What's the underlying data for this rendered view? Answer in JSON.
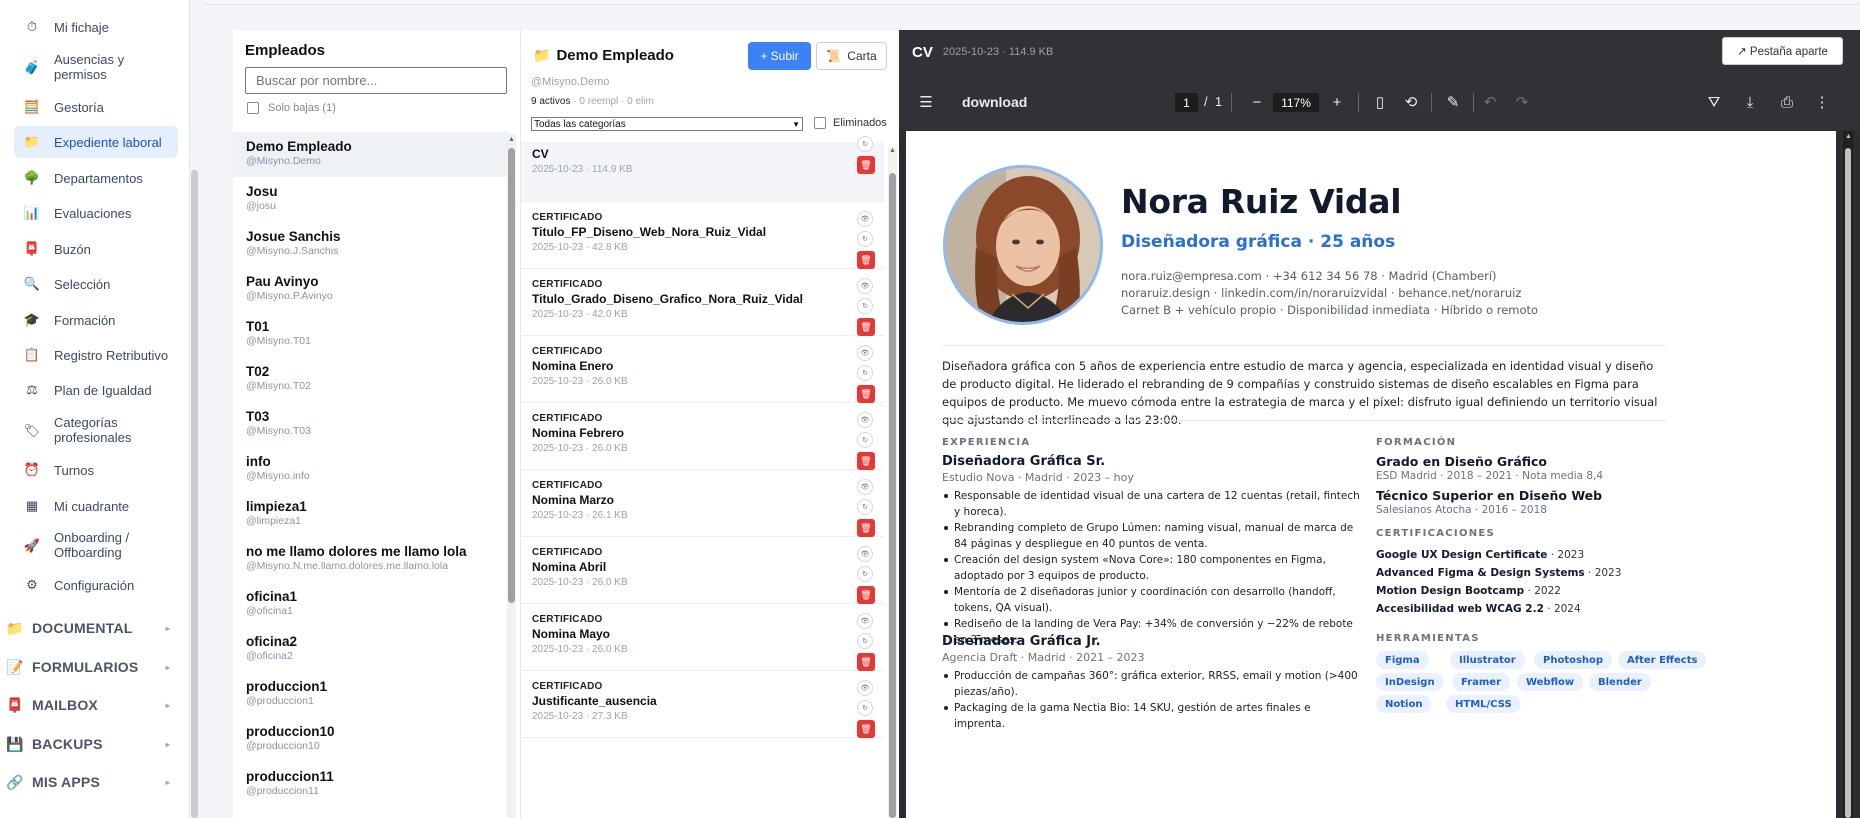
{
  "sidebar": {
    "items": [
      {
        "label": "Mi fichaje",
        "icon": "stopwatch-icon"
      },
      {
        "label": "Ausencias y permisos",
        "icon": "luggage-icon"
      },
      {
        "label": "Gestoría",
        "icon": "calculator-icon"
      },
      {
        "label": "Expediente laboral",
        "icon": "folder-icon",
        "active": true
      },
      {
        "label": "Departamentos",
        "icon": "tree-icon"
      },
      {
        "label": "Evaluaciones",
        "icon": "bar-chart-icon"
      },
      {
        "label": "Buzón",
        "icon": "mailbox-icon"
      },
      {
        "label": "Selección",
        "icon": "magnifier-icon"
      },
      {
        "label": "Formación",
        "icon": "graduation-cap-icon"
      },
      {
        "label": "Registro Retributivo",
        "icon": "clipboard-icon"
      },
      {
        "label": "Plan de Igualdad",
        "icon": "scales-icon"
      },
      {
        "label": "Categorías profesionales",
        "icon": "tag-icon"
      },
      {
        "label": "Turnos",
        "icon": "alarm-clock-icon"
      },
      {
        "label": "Mi cuadrante",
        "icon": "calendar-grid-icon"
      },
      {
        "label": "Onboarding / Offboarding",
        "icon": "rocket-icon"
      },
      {
        "label": "Configuración",
        "icon": "gear-icon"
      }
    ],
    "groups": [
      {
        "label": "DOCUMENTAL",
        "icon": "folder-icon"
      },
      {
        "label": "FORMULARIOS",
        "icon": "form-icon"
      },
      {
        "label": "MAILBOX",
        "icon": "mailbox-icon"
      },
      {
        "label": "BACKUPS",
        "icon": "floppy-icon"
      },
      {
        "label": "MIS APPS",
        "icon": "link-icon"
      }
    ]
  },
  "employees": {
    "title": "Empleados",
    "search_placeholder": "Buscar por nombre...",
    "only_inactive_label": "Solo bajas (1)",
    "list": [
      {
        "name": "Demo Empleado",
        "handle": "@Misyno.Demo"
      },
      {
        "name": "Josu",
        "handle": "@josu"
      },
      {
        "name": "Josue Sanchis",
        "handle": "@Misyno.J.Sanchis"
      },
      {
        "name": "Pau Avinyo",
        "handle": "@Misyno.P.Avinyo"
      },
      {
        "name": "T01",
        "handle": "@Misyno.T01"
      },
      {
        "name": "T02",
        "handle": "@Misyno.T02"
      },
      {
        "name": "T03",
        "handle": "@Misyno.T03"
      },
      {
        "name": "info",
        "handle": "@Misyno.info"
      },
      {
        "name": "limpieza1",
        "handle": "@limpieza1"
      },
      {
        "name": "no me llamo dolores me llamo lola",
        "handle": "@Misyno.N.me.llamo.dolores.me.llamo.lola"
      },
      {
        "name": "oficina1",
        "handle": "@oficina1"
      },
      {
        "name": "oficina2",
        "handle": "@oficina2"
      },
      {
        "name": "produccion1",
        "handle": "@produccion1"
      },
      {
        "name": "produccion10",
        "handle": "@produccion10"
      },
      {
        "name": "produccion11",
        "handle": "@produccion11"
      }
    ]
  },
  "docs": {
    "title": "Demo Empleado",
    "upload_label": "+ Subir",
    "carta_label": "Carta",
    "handle": "@Misyno.Demo",
    "active_count": "9",
    "active_label": "activos",
    "stats_rest": "· 0 reempl · 0 elim",
    "category_select": "Todas las categorías",
    "deleted_label": "Eliminados",
    "list": [
      {
        "kind": "",
        "name": "CV",
        "meta": "2025-10-23 · 114.9 KB"
      },
      {
        "kind": "CERTIFICADO",
        "name": "Titulo_FP_Diseno_Web_Nora_Ruiz_Vidal",
        "meta": "2025-10-23 · 42.8 KB"
      },
      {
        "kind": "CERTIFICADO",
        "name": "Titulo_Grado_Diseno_Grafico_Nora_Ruiz_Vidal",
        "meta": "2025-10-23 · 42.0 KB"
      },
      {
        "kind": "CERTIFICADO",
        "name": "Nomina Enero",
        "meta": "2025-10-23 · 26.0 KB"
      },
      {
        "kind": "CERTIFICADO",
        "name": "Nomina Febrero",
        "meta": "2025-10-23 · 26.0 KB"
      },
      {
        "kind": "CERTIFICADO",
        "name": "Nomina Marzo",
        "meta": "2025-10-23 · 26.1 KB"
      },
      {
        "kind": "CERTIFICADO",
        "name": "Nomina Abril",
        "meta": "2025-10-23 · 26.0 KB"
      },
      {
        "kind": "CERTIFICADO",
        "name": "Nomina Mayo",
        "meta": "2025-10-23 · 26.0 KB"
      },
      {
        "kind": "CERTIFICADO",
        "name": "Justificante_ausencia",
        "meta": "2025-10-23 · 27.3 KB"
      }
    ]
  },
  "viewer": {
    "title": "CV",
    "meta": "2025-10-23 · 114.9 KB",
    "open_tab_label": "↗ Pestaña aparte",
    "toolbar": {
      "filename": "download",
      "page_current": "1",
      "page_separator": "/",
      "page_total": "1",
      "zoom": "117%"
    }
  },
  "cv": {
    "name": "Nora Ruiz Vidal",
    "role": "Diseñadora gráfica · 25 años",
    "contact1": "nora.ruiz@empresa.com · +34 612 34 56 78 · Madrid (Chamberí)",
    "contact2": "noraruiz.design · linkedin.com/in/noraruizvidal · behance.net/noraruiz",
    "contact3": "Carnet B + vehículo propio · Disponibilidad inmediata · Híbrido o remoto",
    "summary": "Diseñadora gráfica con 5 años de experiencia entre estudio de marca y agencia, especializada en identidad visual y diseño de producto digital. He liderado el rebranding de 9 compañías y construido sistemas de diseño escalables en Figma para equipos de producto. Me muevo cómoda entre la estrategia de marca y el píxel: disfruto igual definiendo un territorio visual que ajustando el interlineado a las 23:00.",
    "experience_heading": "EXPERIENCIA",
    "jobs": [
      {
        "title": "Diseñadora Gráfica Sr.",
        "meta": "Estudio Nova · Madrid · 2023 – hoy",
        "bullets": [
          "Responsable de identidad visual de una cartera de 12 cuentas (retail, fintech y horeca).",
          "Rebranding completo de Grupo Lúmen: naming visual, manual de marca de 84 páginas y despliegue en 40 puntos de venta.",
          "Creación del design system «Nova Core»: 180 componentes en Figma, adoptado por 3 equipos de producto.",
          "Mentoría de 2 diseñadoras junior y coordinación con desarrollo (handoff, tokens, QA visual).",
          "Rediseño de la landing de Vera Pay: +34% de conversión y −22% de rebote en 3 meses."
        ]
      },
      {
        "title": "Diseñadora Gráfica Jr.",
        "meta": "Agencia Draft · Madrid · 2021 – 2023",
        "bullets": [
          "Producción de campañas 360°: gráfica exterior, RRSS, email y motion (>400 piezas/año).",
          "Packaging de la gama Nectia Bio: 14 SKU, gestión de artes finales e imprenta."
        ]
      }
    ],
    "education_heading": "FORMACIÓN",
    "education": [
      {
        "title": "Grado en Diseño Gráfico",
        "meta": "ESD Madrid · 2018 – 2021 · Nota media 8,4"
      },
      {
        "title": "Técnico Superior en Diseño Web",
        "meta": "Salesianos Atocha · 2016 – 2018"
      }
    ],
    "certs_heading": "CERTIFICACIONES",
    "certs": [
      {
        "name": "Google UX Design Certificate",
        "year": "· 2023"
      },
      {
        "name": "Advanced Figma & Design Systems",
        "year": "· 2023"
      },
      {
        "name": "Motion Design Bootcamp",
        "year": "· 2022"
      },
      {
        "name": "Accesibilidad web WCAG 2.2",
        "year": "· 2024"
      }
    ],
    "tools_heading": "HERRAMIENTAS",
    "tools": [
      "Figma",
      "Illustrator",
      "Photoshop",
      "After Effects",
      "InDesign",
      "Framer",
      "Webflow",
      "Blender",
      "Notion",
      "HTML/CSS"
    ]
  }
}
